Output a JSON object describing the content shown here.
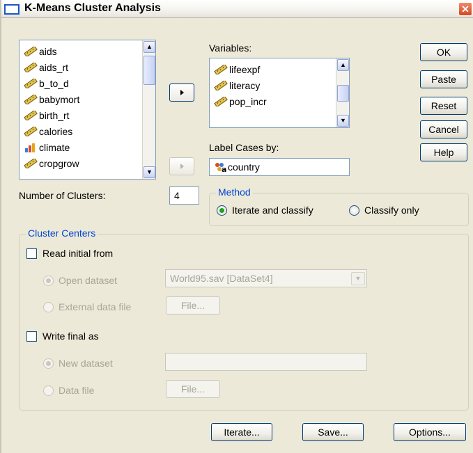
{
  "window": {
    "title": "K-Means Cluster Analysis",
    "close_glyph": "✕"
  },
  "source_list": {
    "items": [
      {
        "label": "aids",
        "icon": "scale-variable-icon"
      },
      {
        "label": "aids_rt",
        "icon": "scale-variable-icon"
      },
      {
        "label": "b_to_d",
        "icon": "scale-variable-icon"
      },
      {
        "label": "babymort",
        "icon": "scale-variable-icon"
      },
      {
        "label": "birth_rt",
        "icon": "scale-variable-icon"
      },
      {
        "label": "calories",
        "icon": "scale-variable-icon"
      },
      {
        "label": "climate",
        "icon": "ordinal-variable-icon"
      },
      {
        "label": "cropgrow",
        "icon": "scale-variable-icon"
      }
    ]
  },
  "variables": {
    "label": "Variables:",
    "items": [
      {
        "label": "lifeexpf",
        "icon": "scale-variable-icon"
      },
      {
        "label": "literacy",
        "icon": "scale-variable-icon"
      },
      {
        "label": "pop_incr",
        "icon": "scale-variable-icon"
      }
    ]
  },
  "label_cases": {
    "label": "Label Cases by:",
    "value": "country",
    "icon": "nominal-string-variable-icon"
  },
  "side_buttons": {
    "ok": "OK",
    "paste": "Paste",
    "reset": "Reset",
    "cancel": "Cancel",
    "help": "Help"
  },
  "clusters": {
    "label": "Number of Clusters:",
    "value": "4"
  },
  "method": {
    "title": "Method",
    "options": [
      "Iterate and classify",
      "Classify only"
    ],
    "selected": "Iterate and classify"
  },
  "cluster_centers": {
    "title": "Cluster Centers",
    "read_initial": {
      "label": "Read initial from",
      "checked": false,
      "open_dataset": "Open dataset",
      "external_file": "External data file",
      "dataset_value": "World95.sav [DataSet4]",
      "file_button": "File..."
    },
    "write_final": {
      "label": "Write final as",
      "checked": false,
      "new_dataset": "New dataset",
      "data_file": "Data file",
      "new_dataset_value": "",
      "file_button": "File..."
    }
  },
  "bottom_buttons": {
    "iterate": "Iterate...",
    "save": "Save...",
    "options": "Options..."
  },
  "colors": {
    "dialog_bg": "#ece9d8",
    "group_title": "#0046d5",
    "radio_selected": "#21a121",
    "button_border": "#003c74"
  }
}
